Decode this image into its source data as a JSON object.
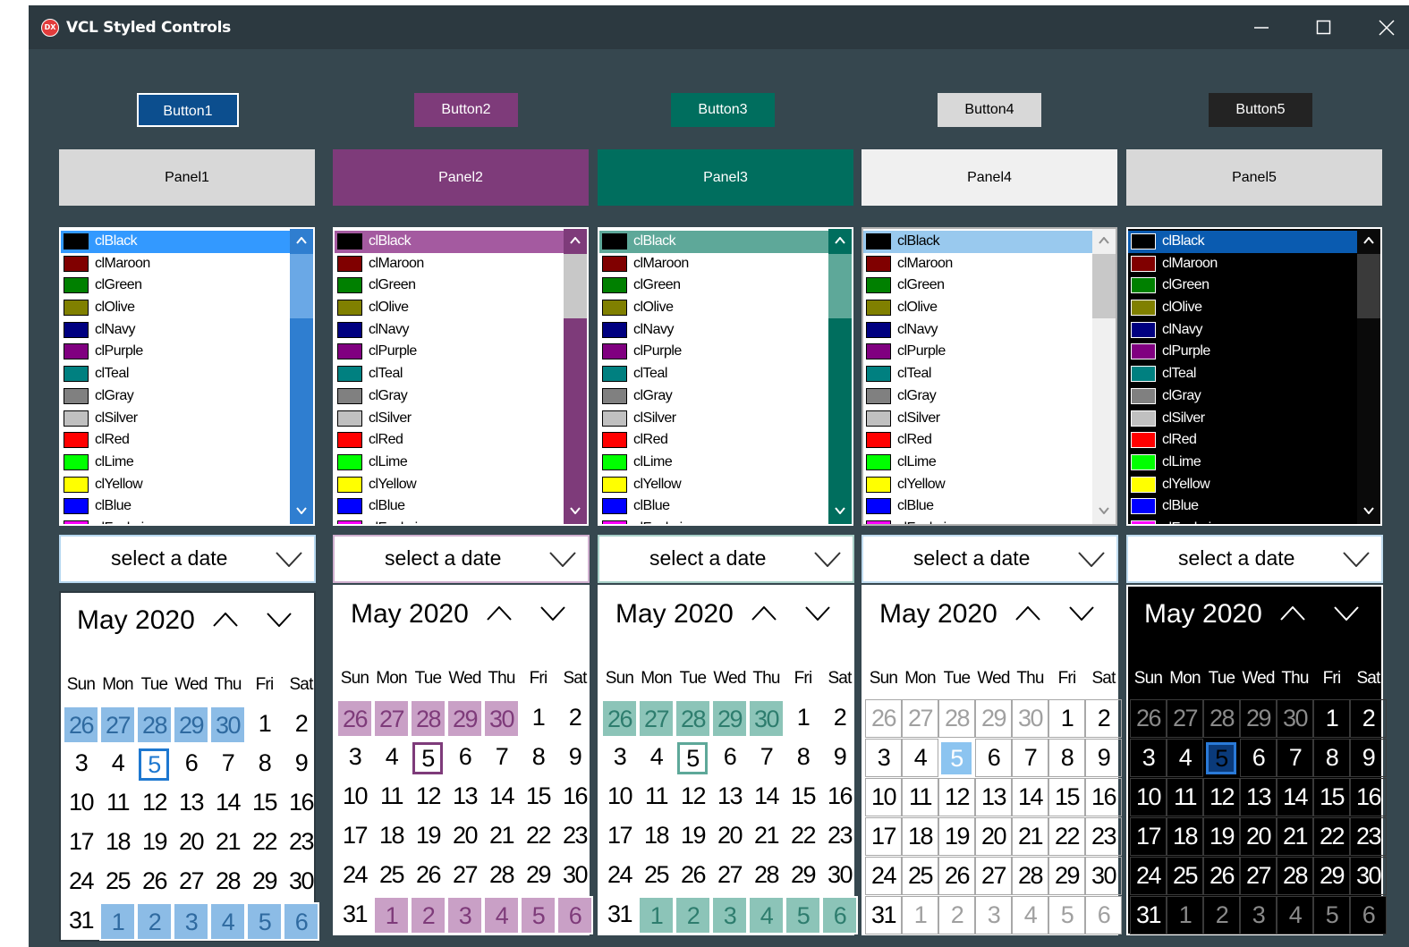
{
  "window": {
    "title": "VCL Styled Controls",
    "icon_text": "DX",
    "icon": "app-logo-icon",
    "controls": [
      "minimize-icon",
      "maximize-icon",
      "close-icon"
    ]
  },
  "buttons": [
    "Button1",
    "Button2",
    "Button3",
    "Button4",
    "Button5"
  ],
  "panels": [
    "Panel1",
    "Panel2",
    "Panel3",
    "Panel4",
    "Panel5"
  ],
  "listbox_items": [
    {
      "name": "clBlack",
      "color": "#000000"
    },
    {
      "name": "clMaroon",
      "color": "#800000"
    },
    {
      "name": "clGreen",
      "color": "#008000"
    },
    {
      "name": "clOlive",
      "color": "#808000"
    },
    {
      "name": "clNavy",
      "color": "#000080"
    },
    {
      "name": "clPurple",
      "color": "#800080"
    },
    {
      "name": "clTeal",
      "color": "#008080"
    },
    {
      "name": "clGray",
      "color": "#808080"
    },
    {
      "name": "clSilver",
      "color": "#c0c0c0"
    },
    {
      "name": "clRed",
      "color": "#ff0000"
    },
    {
      "name": "clLime",
      "color": "#00ff00"
    },
    {
      "name": "clYellow",
      "color": "#ffff00"
    },
    {
      "name": "clBlue",
      "color": "#0000ff"
    },
    {
      "name": "clFuchsia",
      "color": "#ff00ff"
    }
  ],
  "date_picker": {
    "placeholder": "select a date"
  },
  "calendar": {
    "month_year": "May 2020",
    "weekdays": [
      "Sun",
      "Mon",
      "Tue",
      "Wed",
      "Thu",
      "Fri",
      "Sat"
    ],
    "weeks": [
      [
        26,
        27,
        28,
        29,
        30,
        1,
        2
      ],
      [
        3,
        4,
        5,
        6,
        7,
        8,
        9
      ],
      [
        10,
        11,
        12,
        13,
        14,
        15,
        16
      ],
      [
        17,
        18,
        19,
        20,
        21,
        22,
        23
      ],
      [
        24,
        25,
        26,
        27,
        28,
        29,
        30
      ],
      [
        31,
        1,
        2,
        3,
        4,
        5,
        6
      ]
    ],
    "today": 5
  },
  "themes": [
    {
      "name": "blue",
      "window_bg": "#36474f",
      "button_bg": "#0c4e8e",
      "button_fg": "#ffffff",
      "button_border": "#ffffff",
      "panel_bg": "#d8d8d8",
      "panel_fg": "#000000",
      "list_border": "#ffffff",
      "list_bg": "#ffffff",
      "list_fg": "#000000",
      "list_sel_bg": "#3399ff",
      "list_sel_fg": "#ffffff",
      "scroll_bg": "#2f7ed0",
      "scroll_thumb": "#6aa8e6",
      "scroll_arrow": "#ffffff",
      "dp_bg": "#ffffff",
      "dp_border": "#b7d8f0",
      "dp_fg": "#000000",
      "cal_bg": "#ffffff",
      "cal_border": "#2c3940",
      "cal_fg": "#000000",
      "other_bg": "#8cbce6",
      "other_fg": "#2f6aa0",
      "today_border": "#1e78d0",
      "grid": ""
    },
    {
      "name": "purple",
      "window_bg": "#36474f",
      "button_bg": "#7e3b7a",
      "button_fg": "#ffffff",
      "button_border": "#7e3b7a",
      "panel_bg": "#7e3b7a",
      "panel_fg": "#ffffff",
      "list_border": "#ffffff",
      "list_bg": "#ffffff",
      "list_fg": "#000000",
      "list_sel_bg": "#a45aa0",
      "list_sel_fg": "#ffffff",
      "scroll_bg": "#7e3b7a",
      "scroll_thumb": "#c8c8c8",
      "scroll_arrow": "#ffffff",
      "dp_bg": "#ffffff",
      "dp_border": "#d0b0cf",
      "dp_fg": "#000000",
      "cal_bg": "#ffffff",
      "cal_border": "#ffffff",
      "cal_fg": "#000000",
      "other_bg": "#c9a0c6",
      "other_fg": "#7e3b7a",
      "today_border": "#7e3b7a",
      "grid": ""
    },
    {
      "name": "teal",
      "window_bg": "#36474f",
      "button_bg": "#006e5e",
      "button_fg": "#ffffff",
      "button_border": "#006e5e",
      "panel_bg": "#006e5e",
      "panel_fg": "#ffffff",
      "list_border": "#ffffff",
      "list_bg": "#ffffff",
      "list_fg": "#000000",
      "list_sel_bg": "#5ea899",
      "list_sel_fg": "#ffffff",
      "scroll_bg": "#006e5e",
      "scroll_thumb": "#5ea899",
      "scroll_arrow": "#ffffff",
      "dp_bg": "#ffffff",
      "dp_border": "#a8d0c8",
      "dp_fg": "#000000",
      "cal_bg": "#ffffff",
      "cal_border": "#ffffff",
      "cal_fg": "#000000",
      "other_bg": "#8cc4b8",
      "other_fg": "#2e7d6e",
      "today_border": "#5ea899",
      "grid": ""
    },
    {
      "name": "light",
      "window_bg": "#36474f",
      "button_bg": "#d8d8d8",
      "button_fg": "#000000",
      "button_border": "#d8d8d8",
      "panel_bg": "#f0f0f0",
      "panel_fg": "#000000",
      "list_border": "#b0b0b0",
      "list_bg": "#ffffff",
      "list_fg": "#000000",
      "list_sel_bg": "#99c9ee",
      "list_sel_fg": "#000000",
      "scroll_bg": "#f0f0f0",
      "scroll_thumb": "#c8c8c8",
      "scroll_arrow": "#909090",
      "dp_bg": "#ffffff",
      "dp_border": "#c0dcf0",
      "dp_fg": "#000000",
      "cal_bg": "#ffffff",
      "cal_border": "#ffffff",
      "cal_fg": "#000000",
      "other_bg": "#ffffff",
      "other_fg": "#a0a0a0",
      "today_border": "#8cc4f0",
      "grid": "#a8a8a8"
    },
    {
      "name": "dark",
      "window_bg": "#36474f",
      "button_bg": "#232323",
      "button_fg": "#ffffff",
      "button_border": "#232323",
      "panel_bg": "#d8d8d8",
      "panel_fg": "#000000",
      "list_border": "#ffffff",
      "list_bg": "#000000",
      "list_fg": "#ffffff",
      "list_sel_bg": "#0a5bb0",
      "list_sel_fg": "#ffffff",
      "scroll_bg": "#0a0a0a",
      "scroll_thumb": "#3a3a3a",
      "scroll_arrow": "#ffffff",
      "dp_bg": "#ffffff",
      "dp_border": "#c0dcf0",
      "dp_fg": "#000000",
      "cal_bg": "#000000",
      "cal_border": "#ffffff",
      "cal_fg": "#ffffff",
      "other_bg": "#000000",
      "other_fg": "#8a8a8a",
      "today_border": "#2a7ad8",
      "grid": "#3a3a3a"
    }
  ]
}
